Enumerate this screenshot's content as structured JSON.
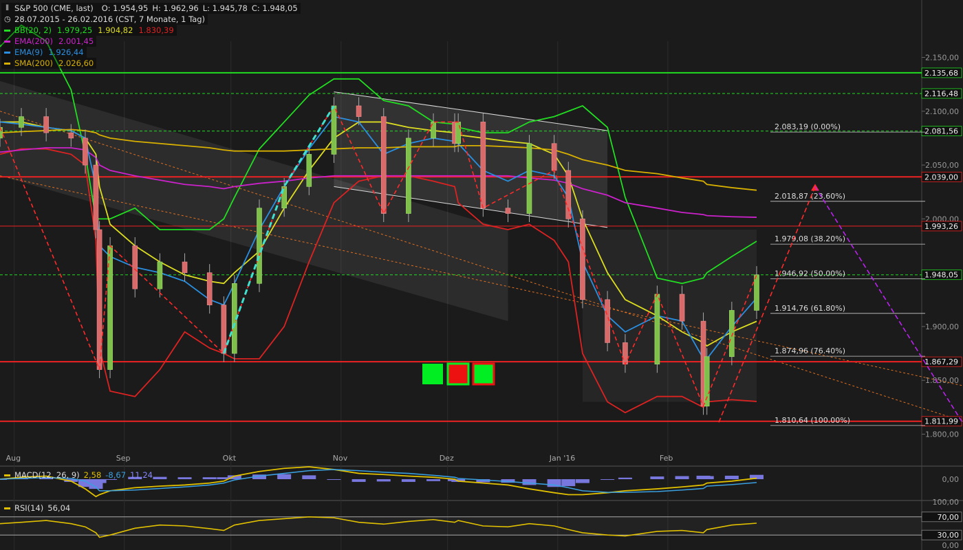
{
  "header": {
    "title_line": "S&P 500 (CME, last)",
    "ohlc": {
      "o": "O: 1.954,95",
      "h": "H: 1.962,96",
      "l": "L: 1.945,78",
      "c": "C: 1.948,05"
    },
    "period": "28.07.2015 - 26.02.2016 (CST, 7 Monate, 1 Tag)",
    "indicators": [
      {
        "name": "BB(20, 2)",
        "color": "#22dd22",
        "values": [
          {
            "text": "1.979,25",
            "color": "#22dd22"
          },
          {
            "text": "1.904,82",
            "color": "#dddd22"
          },
          {
            "text": "1.830,39",
            "color": "#dd2222"
          }
        ]
      },
      {
        "name": "EMA(200)",
        "color": "#cc22cc",
        "values": [
          {
            "text": "2.001,45",
            "color": "#cc22cc"
          }
        ]
      },
      {
        "name": "EMA(9)",
        "color": "#2a8fe0",
        "values": [
          {
            "text": "1.926,44",
            "color": "#2a8fe0"
          }
        ]
      },
      {
        "name": "SMA(200)",
        "color": "#d8b000",
        "values": [
          {
            "text": "2.026,60",
            "color": "#d8b000"
          }
        ]
      }
    ]
  },
  "macd_legend": {
    "label": "MACD(12, 26, 9)",
    "v1": "2,58",
    "v2": "-8,67",
    "v3": "11,24",
    "color": "#e0c000",
    "c2": "#3aa0e0",
    "c3": "#8888ff"
  },
  "rsi_legend": {
    "label": "RSI(14)",
    "value": "56,04",
    "color": "#e0c000"
  },
  "chart_data": {
    "type": "candlestick",
    "y_ticks": [
      "2.150,00",
      "2.100,00",
      "2.050,00",
      "2.000,00",
      "1.900,00",
      "1.850,00",
      "1.800,00"
    ],
    "y_tick_values": [
      2150,
      2100,
      2050,
      2000,
      1900,
      1850,
      1800
    ],
    "x_labels": [
      "Aug",
      "Sep",
      "Okt",
      "Nov",
      "Dez",
      "Jan '16",
      "Feb"
    ],
    "x_label_dates": [
      "2015-08-01",
      "2015-09-01",
      "2015-10-01",
      "2015-11-01",
      "2015-12-01",
      "2016-01-01",
      "2016-02-01"
    ],
    "ylim": [
      1785,
      2165
    ],
    "xlim": [
      "2015-07-28",
      "2016-02-26"
    ],
    "horizontal_levels": [
      {
        "value": 2135.68,
        "label": "2.135,68",
        "color": "#22dd22",
        "style": "solid"
      },
      {
        "value": 2116.48,
        "label": "2.116,48",
        "color": "#22dd22",
        "style": "dashed"
      },
      {
        "value": 2081.56,
        "label": "2.081,56",
        "color": "#22dd22",
        "style": "dashed"
      },
      {
        "value": 2039.0,
        "label": "2.039,00",
        "color": "#ee2222",
        "style": "solid"
      },
      {
        "value": 1993.26,
        "label": "1.993,26",
        "color": "#ee2222",
        "style": "solid-thin"
      },
      {
        "value": 1948.05,
        "label": "1.948,05",
        "color": "#22dd22",
        "style": "dashed"
      },
      {
        "value": 1867.29,
        "label": "1.867,29",
        "color": "#ee2222",
        "style": "solid"
      },
      {
        "value": 1811.99,
        "label": "1.811,99",
        "color": "#ee2222",
        "style": "solid"
      }
    ],
    "fibonacci": [
      {
        "value": 2083.19,
        "label": "2.083,19 (0.00%)"
      },
      {
        "value": 2018.87,
        "label": "2.018,87 (23.60%)"
      },
      {
        "value": 1979.08,
        "label": "1.979,08 (38.20%)"
      },
      {
        "value": 1946.92,
        "label": "1.946,92 (50.00%)"
      },
      {
        "value": 1914.76,
        "label": "1.914,76 (61.80%)"
      },
      {
        "value": 1874.96,
        "label": "1.874,96 (76.40%)"
      },
      {
        "value": 1810.64,
        "label": "1.810,64 (100.00%)"
      }
    ],
    "candles": {
      "dates": [
        "2015-07-28",
        "2015-08-03",
        "2015-08-10",
        "2015-08-17",
        "2015-08-21",
        "2015-08-24",
        "2015-08-25",
        "2015-08-28",
        "2015-09-04",
        "2015-09-11",
        "2015-09-18",
        "2015-09-25",
        "2015-09-29",
        "2015-10-02",
        "2015-10-09",
        "2015-10-16",
        "2015-10-23",
        "2015-10-30",
        "2015-11-06",
        "2015-11-13",
        "2015-11-20",
        "2015-11-27",
        "2015-12-03",
        "2015-12-04",
        "2015-12-11",
        "2015-12-18",
        "2015-12-24",
        "2015-12-31",
        "2016-01-04",
        "2016-01-08",
        "2016-01-15",
        "2016-01-20",
        "2016-01-29",
        "2016-02-05",
        "2016-02-11",
        "2016-02-12",
        "2016-02-19",
        "2016-02-26"
      ],
      "close": [
        2085,
        2095,
        2080,
        2075,
        2050,
        1990,
        1860,
        1975,
        1935,
        1960,
        1950,
        1920,
        1875,
        1940,
        2010,
        2030,
        2060,
        2105,
        2095,
        2005,
        2075,
        2090,
        2070,
        2090,
        2010,
        2005,
        2070,
        2045,
        2000,
        1925,
        1885,
        1865,
        1930,
        1905,
        1826,
        1872,
        1915,
        1948.05
      ]
    },
    "series": [
      {
        "name": "BB(20, 2) upper",
        "color": "#22dd22",
        "values": [
          2160,
          2180,
          2165,
          2120,
          2060,
          2000,
          2000,
          2000,
          2010,
          1990,
          1990,
          1990,
          2000,
          2020,
          2065,
          2090,
          2115,
          2130,
          2130,
          2110,
          2105,
          2090,
          2088,
          2085,
          2080,
          2080,
          2090,
          2095,
          2100,
          2105,
          2085,
          2020,
          1945,
          1940,
          1945,
          1950,
          1965,
          1979.25
        ]
      },
      {
        "name": "BB(20, 2) middle",
        "color": "#dddd22",
        "values": [
          2090,
          2090,
          2085,
          2082,
          2075,
          2060,
          2030,
          1995,
          1975,
          1960,
          1948,
          1942,
          1940,
          1950,
          1970,
          2010,
          2045,
          2075,
          2090,
          2090,
          2085,
          2082,
          2080,
          2078,
          2075,
          2072,
          2070,
          2060,
          2040,
          2000,
          1950,
          1925,
          1910,
          1895,
          1885,
          1882,
          1895,
          1904.82
        ]
      },
      {
        "name": "BB(20, 2) lower",
        "color": "#dd2222",
        "values": [
          2060,
          2065,
          2065,
          2060,
          2050,
          1980,
          1880,
          1840,
          1835,
          1860,
          1895,
          1880,
          1875,
          1870,
          1870,
          1900,
          1960,
          2015,
          2035,
          2040,
          2040,
          2035,
          2030,
          2015,
          1995,
          1990,
          1995,
          1980,
          1960,
          1875,
          1830,
          1820,
          1835,
          1835,
          1825,
          1830,
          1832,
          1830.39
        ]
      },
      {
        "name": "EMA(200)",
        "color": "#cc22cc",
        "values": [
          2062,
          2064,
          2066,
          2066,
          2064,
          2057,
          2050,
          2045,
          2040,
          2036,
          2032,
          2030,
          2028,
          2030,
          2033,
          2035,
          2038,
          2040,
          2040,
          2040,
          2040,
          2040,
          2040,
          2040,
          2040,
          2040,
          2038,
          2036,
          2033,
          2028,
          2022,
          2015,
          2010,
          2006,
          2004,
          2003,
          2002,
          2001.45
        ]
      },
      {
        "name": "EMA(9)",
        "color": "#2a8fe0",
        "values": [
          2090,
          2088,
          2085,
          2082,
          2075,
          2030,
          1975,
          1965,
          1955,
          1950,
          1942,
          1925,
          1920,
          1940,
          1990,
          2030,
          2065,
          2095,
          2090,
          2060,
          2070,
          2075,
          2072,
          2070,
          2045,
          2035,
          2045,
          2040,
          2020,
          1960,
          1910,
          1895,
          1910,
          1905,
          1870,
          1870,
          1900,
          1926.44
        ]
      },
      {
        "name": "SMA(200)",
        "color": "#d8b000",
        "values": [
          2080,
          2081,
          2082,
          2083,
          2082,
          2080,
          2078,
          2075,
          2072,
          2070,
          2068,
          2066,
          2064,
          2063,
          2063,
          2063,
          2064,
          2065,
          2066,
          2066,
          2067,
          2067,
          2067,
          2068,
          2068,
          2067,
          2066,
          2064,
          2060,
          2055,
          2050,
          2045,
          2042,
          2038,
          2035,
          2032,
          2029,
          2026.6
        ]
      }
    ],
    "projection_min": 1811,
    "projection_target": 2030,
    "macd": {
      "line": [
        0,
        5,
        8,
        -5,
        -25,
        -45,
        -40,
        -30,
        -22,
        -18,
        -15,
        -10,
        -5,
        8,
        20,
        28,
        32,
        25,
        15,
        12,
        8,
        5,
        0,
        -5,
        -10,
        -15,
        -25,
        -35,
        -40,
        -40,
        -35,
        -30,
        -25,
        -20,
        -15,
        -10,
        -5,
        2.58
      ],
      "signal": [
        0,
        2,
        4,
        2,
        -5,
        -20,
        -30,
        -30,
        -28,
        -24,
        -20,
        -15,
        -10,
        -2,
        8,
        15,
        22,
        25,
        22,
        18,
        15,
        10,
        5,
        2,
        -2,
        -6,
        -10,
        -15,
        -22,
        -30,
        -34,
        -34,
        -32,
        -28,
        -24,
        -18,
        -14,
        -8.67
      ],
      "hist": [
        0,
        3,
        4,
        -7,
        -20,
        -25,
        -10,
        0,
        6,
        6,
        5,
        5,
        5,
        10,
        12,
        13,
        10,
        0,
        -7,
        -6,
        -7,
        -5,
        -5,
        -7,
        -8,
        -9,
        -15,
        -20,
        -18,
        -10,
        -1,
        4,
        7,
        8,
        9,
        8,
        9,
        11.24
      ]
    },
    "rsi": {
      "values": [
        55,
        58,
        62,
        55,
        48,
        35,
        25,
        30,
        45,
        52,
        50,
        44,
        40,
        52,
        62,
        66,
        70,
        68,
        58,
        54,
        60,
        64,
        58,
        62,
        50,
        48,
        55,
        50,
        42,
        35,
        30,
        28,
        38,
        40,
        35,
        42,
        52,
        56.04
      ],
      "levels": [
        70,
        30
      ],
      "ylim": [
        0,
        100
      ]
    }
  }
}
